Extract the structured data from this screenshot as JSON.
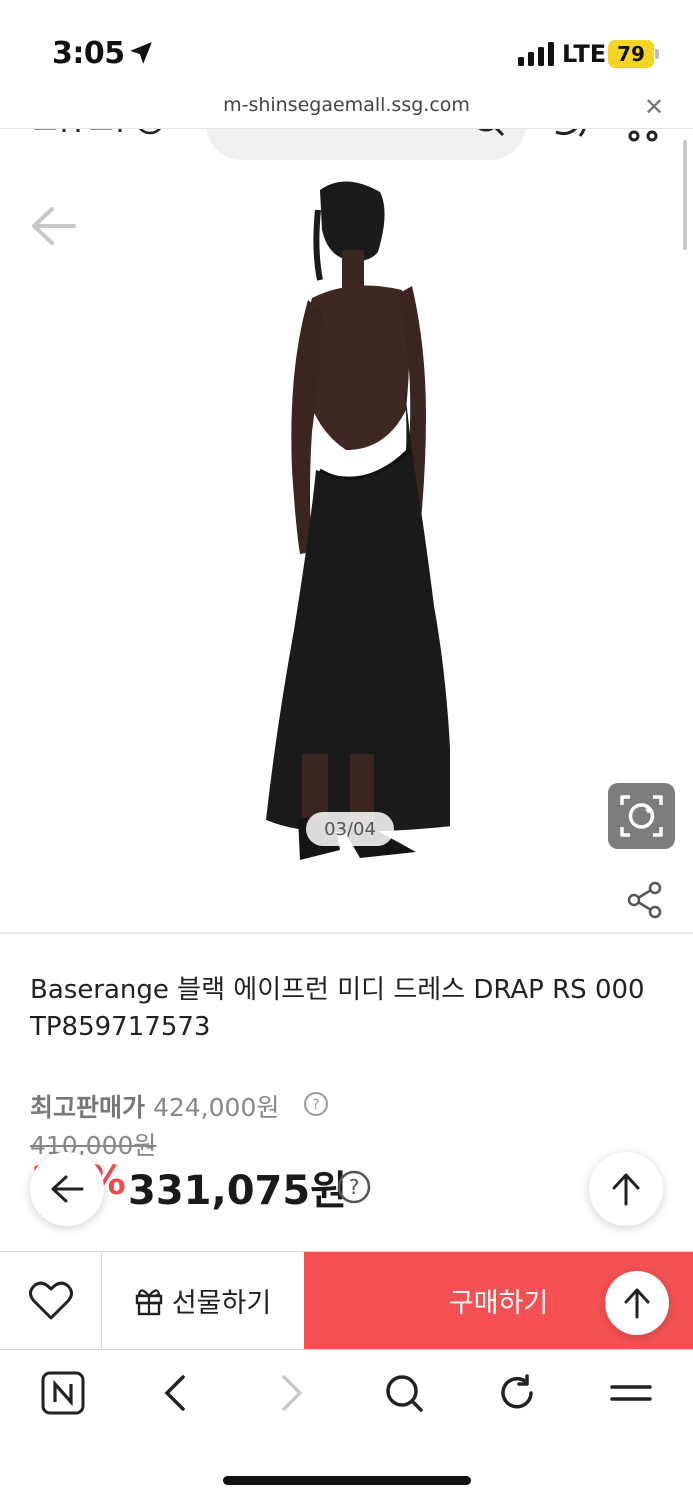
{
  "status_bar": {
    "time": "3:05",
    "network": "LTE",
    "battery": "79"
  },
  "browser": {
    "url": "m-shinsegaemall.ssg.com"
  },
  "gallery": {
    "counter": "03/04"
  },
  "product": {
    "title_line1": "Baserange 블랙 에이프런 미디 드레스 DRAP RS 000",
    "title_line2": "TP859717573",
    "best_price_label": "최고판매가",
    "best_price": "424,000원",
    "original_price": "410,000원",
    "discount": "19%",
    "sale_price": "331,075원"
  },
  "actions": {
    "gift_label": "선물하기",
    "buy_label": "구매하기"
  },
  "colors": {
    "accent": "#f55153",
    "discount": "#f24b4b"
  }
}
